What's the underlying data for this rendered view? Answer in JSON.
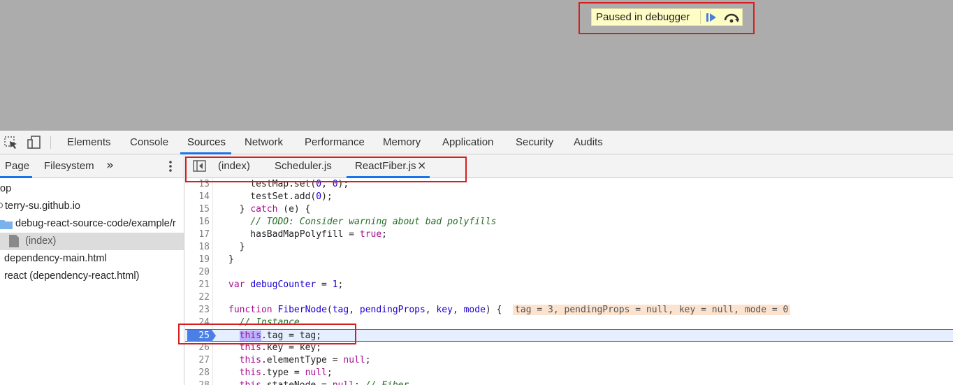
{
  "page": {
    "paused_text": "Paused in debugger"
  },
  "devtools": {
    "tabs": [
      "Elements",
      "Console",
      "Sources",
      "Network",
      "Performance",
      "Memory",
      "Application",
      "Security",
      "Audits"
    ],
    "active_tab": "Sources"
  },
  "navigator": {
    "tabs": [
      "Page",
      "Filesystem"
    ],
    "more": "»",
    "tree": [
      {
        "label": "op"
      },
      {
        "label": "terry-su.github.io"
      },
      {
        "label": "debug-react-source-code/example/r"
      },
      {
        "label": "(index)"
      },
      {
        "label": "dependency-main.html"
      },
      {
        "label": "react (dependency-react.html)"
      }
    ]
  },
  "editor": {
    "tabs": [
      "(index)",
      "Scheduler.js",
      "ReactFiber.js"
    ],
    "close_glyph": "×",
    "line_numbers": [
      "13",
      "14",
      "15",
      "16",
      "17",
      "18",
      "19",
      "20",
      "21",
      "22",
      "23",
      "24",
      "25",
      "26",
      "27",
      "28"
    ],
    "inline_values": "tag = 3, pendingProps = null, key = null, mode = 0"
  },
  "colors": {
    "accent": "#1a73e8",
    "highlight_box": "#d61e1e",
    "paused_bg": "#fffdc6",
    "exec_line_bg": "#e6efff"
  }
}
